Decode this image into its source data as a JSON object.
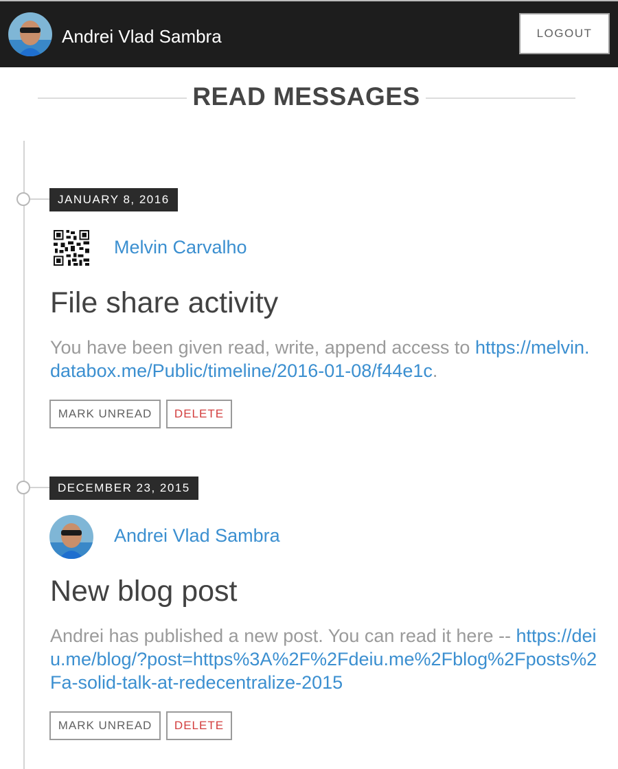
{
  "header": {
    "user_name": "Andrei Vlad Sambra",
    "logout_label": "LOGOUT"
  },
  "page": {
    "title": "READ MESSAGES"
  },
  "messages": [
    {
      "date": "JANUARY 8, 2016",
      "sender": "Melvin Carvalho",
      "sender_icon": "qr-code-icon",
      "title": "File share activity",
      "body_text": "You have been given read, write, append access to ",
      "body_link": "https://melvin.databox.me/Public/timeline/2016-01-08/f44e1c",
      "body_suffix": ".",
      "mark_unread_label": "MARK UNREAD",
      "delete_label": "DELETE"
    },
    {
      "date": "DECEMBER 23, 2015",
      "sender": "Andrei Vlad Sambra",
      "sender_icon": "avatar-photo-icon",
      "title": "New blog post",
      "body_text": "Andrei has published a new post. You can read it here -- ",
      "body_link": "https://deiu.me/blog/?post=https%3A%2F%2Fdeiu.me%2Fblog%2Fposts%2Fa-solid-talk-at-redecentralize-2015",
      "body_suffix": "",
      "mark_unread_label": "MARK UNREAD",
      "delete_label": "DELETE"
    }
  ],
  "colors": {
    "header_bg": "#1d1d1d",
    "link": "#3b8fd0",
    "delete": "#d23c3c",
    "badge_bg": "#2b2b2b"
  }
}
